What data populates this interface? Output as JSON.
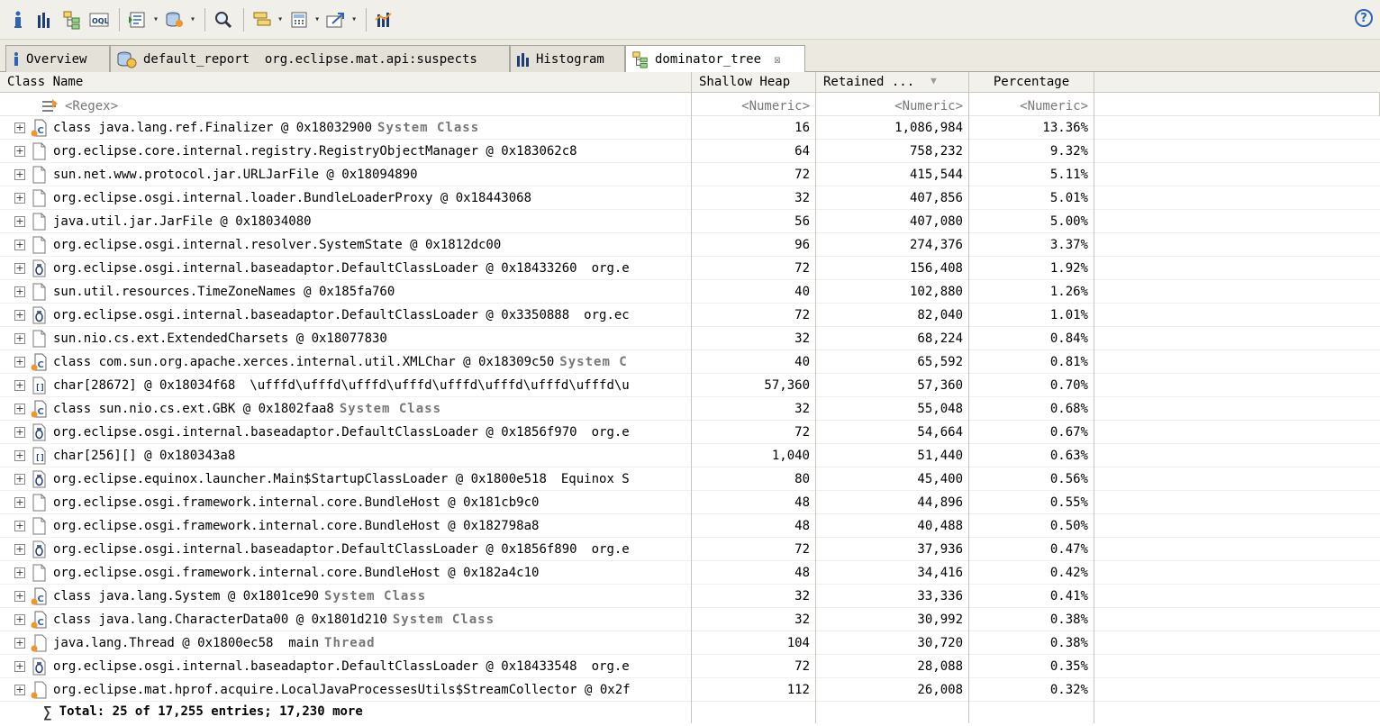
{
  "toolbar": {
    "buttons": [
      {
        "icon": "info-icon"
      },
      {
        "icon": "histogram-icon"
      },
      {
        "icon": "dominator-tree-icon"
      },
      {
        "icon": "oql-icon"
      },
      {
        "icon": "run-report-icon",
        "dropdown": true
      },
      {
        "icon": "heap-dump-icon",
        "dropdown": true
      },
      {
        "icon": "search-icon"
      },
      {
        "icon": "group-icon",
        "dropdown": true
      },
      {
        "icon": "calculator-icon",
        "dropdown": true
      },
      {
        "icon": "export-icon",
        "dropdown": true
      },
      {
        "icon": "compare-icon"
      }
    ],
    "help": "?"
  },
  "tabs": [
    {
      "label": "Overview",
      "icon": "info-icon",
      "active": false
    },
    {
      "label": "default_report  org.eclipse.mat.api:suspects",
      "icon": "report-icon",
      "active": false
    },
    {
      "label": "Histogram",
      "icon": "histogram-icon",
      "active": false
    },
    {
      "label": "dominator_tree",
      "icon": "dominator-tree-icon",
      "active": true
    }
  ],
  "tab_close": "☒",
  "columns": {
    "name": "Class Name",
    "shallow": "Shallow Heap",
    "retained": "Retained ...",
    "percentage": "Percentage"
  },
  "sort_indicator": "▼",
  "filter": {
    "name": "<Regex>",
    "shallow": "<Numeric>",
    "retained": "<Numeric>",
    "percentage": "<Numeric>"
  },
  "rows": [
    {
      "icon": "class",
      "name": "class java.lang.ref.Finalizer @ 0x18032900",
      "suffix": "System Class",
      "suffix_style": "bold",
      "shallow": "16",
      "retained": "1,086,984",
      "pct": "13.36%"
    },
    {
      "icon": "object",
      "name": "org.eclipse.core.internal.registry.RegistryObjectManager @ 0x183062c8",
      "suffix": "",
      "suffix_style": "",
      "shallow": "64",
      "retained": "758,232",
      "pct": "9.32%"
    },
    {
      "icon": "object",
      "name": "sun.net.www.protocol.jar.URLJarFile @ 0x18094890",
      "suffix": "",
      "suffix_style": "",
      "shallow": "72",
      "retained": "415,544",
      "pct": "5.11%"
    },
    {
      "icon": "object",
      "name": "org.eclipse.osgi.internal.loader.BundleLoaderProxy @ 0x18443068",
      "suffix": "",
      "suffix_style": "",
      "shallow": "32",
      "retained": "407,856",
      "pct": "5.01%"
    },
    {
      "icon": "object",
      "name": "java.util.jar.JarFile @ 0x18034080",
      "suffix": "",
      "suffix_style": "",
      "shallow": "56",
      "retained": "407,080",
      "pct": "5.00%"
    },
    {
      "icon": "object",
      "name": "org.eclipse.osgi.internal.resolver.SystemState @ 0x1812dc00",
      "suffix": "",
      "suffix_style": "",
      "shallow": "96",
      "retained": "274,376",
      "pct": "3.37%"
    },
    {
      "icon": "classloader",
      "name": "org.eclipse.osgi.internal.baseadaptor.DefaultClassLoader @ 0x18433260",
      "suffix": "org.e",
      "suffix_style": "plain",
      "shallow": "72",
      "retained": "156,408",
      "pct": "1.92%"
    },
    {
      "icon": "object",
      "name": "sun.util.resources.TimeZoneNames @ 0x185fa760",
      "suffix": "",
      "suffix_style": "",
      "shallow": "40",
      "retained": "102,880",
      "pct": "1.26%"
    },
    {
      "icon": "classloader",
      "name": "org.eclipse.osgi.internal.baseadaptor.DefaultClassLoader @ 0x3350888",
      "suffix": "org.ec",
      "suffix_style": "plain",
      "shallow": "72",
      "retained": "82,040",
      "pct": "1.01%"
    },
    {
      "icon": "object",
      "name": "sun.nio.cs.ext.ExtendedCharsets @ 0x18077830",
      "suffix": "",
      "suffix_style": "",
      "shallow": "32",
      "retained": "68,224",
      "pct": "0.84%"
    },
    {
      "icon": "class",
      "name": "class com.sun.org.apache.xerces.internal.util.XMLChar @ 0x18309c50",
      "suffix": "System C",
      "suffix_style": "bold",
      "shallow": "40",
      "retained": "65,592",
      "pct": "0.81%"
    },
    {
      "icon": "array",
      "name": "char[28672] @ 0x18034f68",
      "suffix": "\\ufffd\\ufffd\\ufffd\\ufffd\\ufffd\\ufffd\\ufffd\\ufffd\\u",
      "suffix_style": "plain",
      "shallow": "57,360",
      "retained": "57,360",
      "pct": "0.70%"
    },
    {
      "icon": "class",
      "name": "class sun.nio.cs.ext.GBK @ 0x1802faa8",
      "suffix": "System Class",
      "suffix_style": "bold",
      "shallow": "32",
      "retained": "55,048",
      "pct": "0.68%"
    },
    {
      "icon": "classloader",
      "name": "org.eclipse.osgi.internal.baseadaptor.DefaultClassLoader @ 0x1856f970",
      "suffix": "org.e",
      "suffix_style": "plain",
      "shallow": "72",
      "retained": "54,664",
      "pct": "0.67%"
    },
    {
      "icon": "array",
      "name": "char[256][] @ 0x180343a8",
      "suffix": "",
      "suffix_style": "",
      "shallow": "1,040",
      "retained": "51,440",
      "pct": "0.63%"
    },
    {
      "icon": "classloader",
      "name": "org.eclipse.equinox.launcher.Main$StartupClassLoader @ 0x1800e518",
      "suffix": "Equinox S",
      "suffix_style": "plain",
      "shallow": "80",
      "retained": "45,400",
      "pct": "0.56%"
    },
    {
      "icon": "object",
      "name": "org.eclipse.osgi.framework.internal.core.BundleHost @ 0x181cb9c0",
      "suffix": "",
      "suffix_style": "",
      "shallow": "48",
      "retained": "44,896",
      "pct": "0.55%"
    },
    {
      "icon": "object",
      "name": "org.eclipse.osgi.framework.internal.core.BundleHost @ 0x182798a8",
      "suffix": "",
      "suffix_style": "",
      "shallow": "48",
      "retained": "40,488",
      "pct": "0.50%"
    },
    {
      "icon": "classloader",
      "name": "org.eclipse.osgi.internal.baseadaptor.DefaultClassLoader @ 0x1856f890",
      "suffix": "org.e",
      "suffix_style": "plain",
      "shallow": "72",
      "retained": "37,936",
      "pct": "0.47%"
    },
    {
      "icon": "object",
      "name": "org.eclipse.osgi.framework.internal.core.BundleHost @ 0x182a4c10",
      "suffix": "",
      "suffix_style": "",
      "shallow": "48",
      "retained": "34,416",
      "pct": "0.42%"
    },
    {
      "icon": "class",
      "name": "class java.lang.System @ 0x1801ce90",
      "suffix": "System Class",
      "suffix_style": "bold",
      "shallow": "32",
      "retained": "33,336",
      "pct": "0.41%"
    },
    {
      "icon": "class",
      "name": "class java.lang.CharacterData00 @ 0x1801d210",
      "suffix": "System Class",
      "suffix_style": "bold",
      "shallow": "32",
      "retained": "30,992",
      "pct": "0.38%"
    },
    {
      "icon": "gcroot-object",
      "name": "java.lang.Thread @ 0x1800ec58  main",
      "suffix": "Thread",
      "suffix_style": "bold",
      "shallow": "104",
      "retained": "30,720",
      "pct": "0.38%"
    },
    {
      "icon": "classloader",
      "name": "org.eclipse.osgi.internal.baseadaptor.DefaultClassLoader @ 0x18433548",
      "suffix": "org.e",
      "suffix_style": "plain",
      "shallow": "72",
      "retained": "28,088",
      "pct": "0.35%"
    },
    {
      "icon": "gcroot-object",
      "name": "org.eclipse.mat.hprof.acquire.LocalJavaProcessesUtils$StreamCollector @ 0x2f",
      "suffix": "",
      "suffix_style": "",
      "shallow": "112",
      "retained": "26,008",
      "pct": "0.32%"
    }
  ],
  "expander": "+",
  "total": "Total: 25 of 17,255 entries; 17,230 more",
  "sigma": "∑",
  "colors": {
    "accent": "#2d64b6",
    "gc_root_marker": "#f0962b",
    "suffix_gray": "#777777"
  }
}
